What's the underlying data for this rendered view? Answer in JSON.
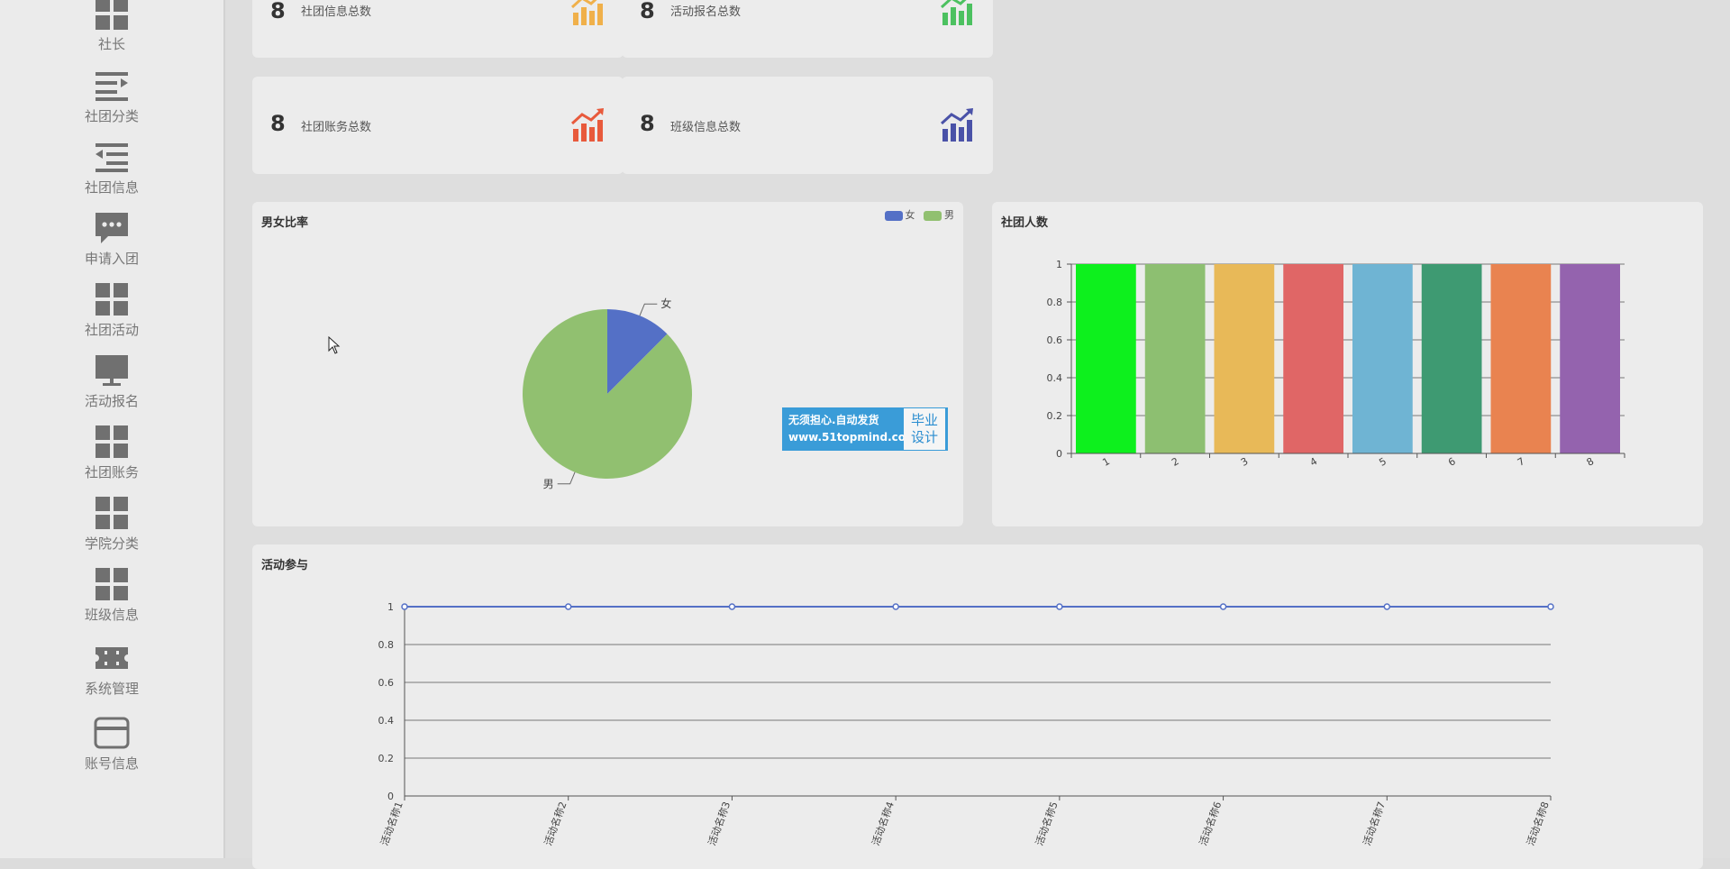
{
  "sidebar": {
    "items": [
      {
        "label": "社长",
        "icon": "grid-icon"
      },
      {
        "label": "社团分类",
        "icon": "indent-list-icon"
      },
      {
        "label": "社团信息",
        "icon": "outdent-list-icon"
      },
      {
        "label": "申请入团",
        "icon": "chat-bubble-icon"
      },
      {
        "label": "社团活动",
        "icon": "grid-icon"
      },
      {
        "label": "活动报名",
        "icon": "monitor-icon"
      },
      {
        "label": "社团账务",
        "icon": "grid-icon"
      },
      {
        "label": "学院分类",
        "icon": "grid-icon"
      },
      {
        "label": "班级信息",
        "icon": "grid-icon"
      },
      {
        "label": "系统管理",
        "icon": "ticket-icon"
      },
      {
        "label": "账号信息",
        "icon": "card-icon"
      }
    ]
  },
  "stats": [
    {
      "value": "8",
      "label": "社团信息总数",
      "icon_color": "#f0b04a"
    },
    {
      "value": "8",
      "label": "活动报名总数",
      "icon_color": "#4cc160"
    },
    {
      "value": "8",
      "label": "社团账务总数",
      "icon_color": "#e85a3c"
    },
    {
      "value": "8",
      "label": "班级信息总数",
      "icon_color": "#4a52a8"
    }
  ],
  "watermark": {
    "line1": "无须担心.自动发货",
    "line2": "www.51topmind.com",
    "right1": "毕业",
    "right2": "设计"
  },
  "chart_data": [
    {
      "type": "pie",
      "title": "男女比率",
      "legend": [
        "女",
        "男"
      ],
      "legend_position": "top-right",
      "slices": [
        {
          "name": "女",
          "value": 1,
          "color": "#5470c6"
        },
        {
          "name": "男",
          "value": 7,
          "color": "#91c070"
        }
      ]
    },
    {
      "type": "bar",
      "title": "社团人数",
      "categories": [
        "1",
        "2",
        "3",
        "4",
        "5",
        "6",
        "7",
        "8"
      ],
      "values": [
        1,
        1,
        1,
        1,
        1,
        1,
        1,
        1
      ],
      "colors": [
        "#0df01d",
        "#8dbf71",
        "#e8b958",
        "#e06666",
        "#6fb4d3",
        "#3e9a72",
        "#e98350",
        "#9463ae"
      ],
      "ylim": [
        0,
        1
      ],
      "yticks": [
        "0",
        "0.2",
        "0.4",
        "0.6",
        "0.8",
        "1"
      ],
      "grid": true
    },
    {
      "type": "line",
      "title": "活动参与",
      "categories": [
        "活动名称1",
        "活动名称2",
        "活动名称3",
        "活动名称4",
        "活动名称5",
        "活动名称6",
        "活动名称7",
        "活动名称8"
      ],
      "values": [
        1,
        1,
        1,
        1,
        1,
        1,
        1,
        1
      ],
      "color": "#5470c6",
      "ylim": [
        0,
        1
      ],
      "yticks": [
        "0",
        "0.2",
        "0.4",
        "0.6",
        "0.8",
        "1"
      ],
      "grid": true
    }
  ]
}
